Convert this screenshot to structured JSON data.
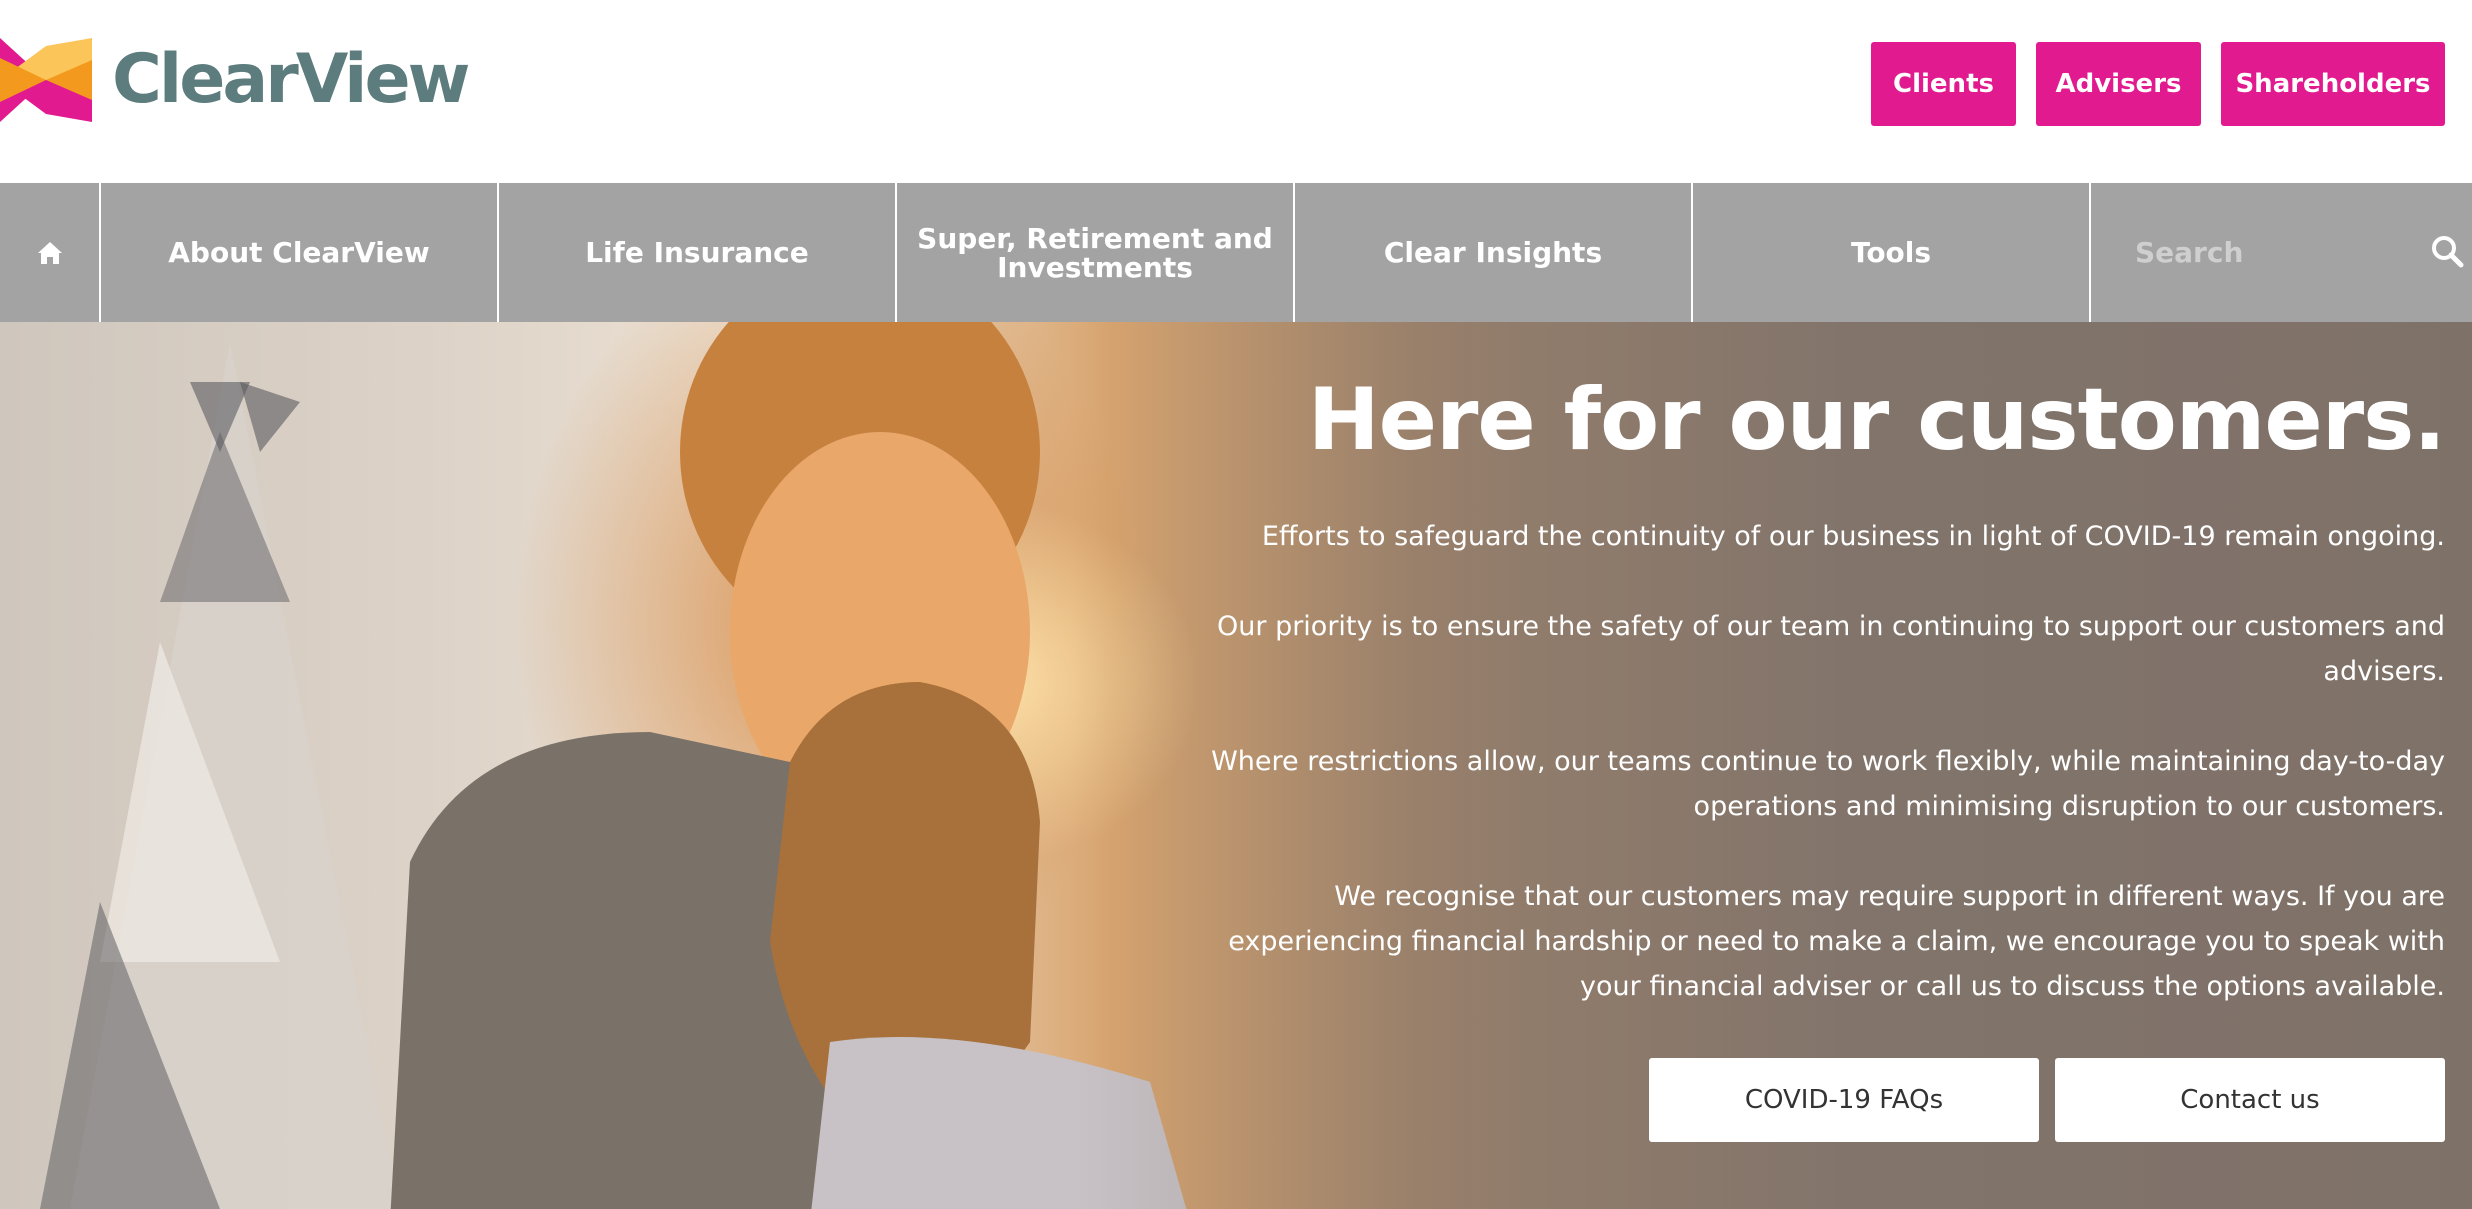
{
  "brand": {
    "name": "ClearView",
    "colors": {
      "magenta": "#e11b8f",
      "orange": "#f39a1e",
      "yellow": "#fcc55a",
      "teal": "#5d7c7e",
      "nav_gray": "#a3a3a3"
    }
  },
  "header": {
    "buttons": [
      {
        "label": "Clients"
      },
      {
        "label": "Advisers"
      },
      {
        "label": "Shareholders"
      }
    ]
  },
  "nav": {
    "home_icon": "home-icon",
    "items": [
      {
        "label": "About ClearView"
      },
      {
        "label": "Life Insurance"
      },
      {
        "label": "Super, Retirement and Investments"
      },
      {
        "label": "Clear Insights"
      },
      {
        "label": "Tools"
      }
    ],
    "search": {
      "placeholder": "Search",
      "icon": "search-icon"
    }
  },
  "hero": {
    "title": "Here for our customers.",
    "paragraphs": [
      "Efforts to safeguard the continuity of our business in light of COVID-19 remain ongoing.",
      "Our priority is to ensure the safety of our team in continuing to support our customers and advisers.",
      "Where restrictions allow, our teams continue to work flexibly, while maintaining day-to-day operations and minimising disruption to our customers.",
      "We recognise that our customers may require support in different ways. If you are experiencing financial hardship or need to make a claim, we encourage you to speak with your financial adviser or call us to discuss the options available."
    ],
    "buttons": [
      {
        "label": "COVID-19 FAQs"
      },
      {
        "label": "Contact us"
      }
    ]
  }
}
